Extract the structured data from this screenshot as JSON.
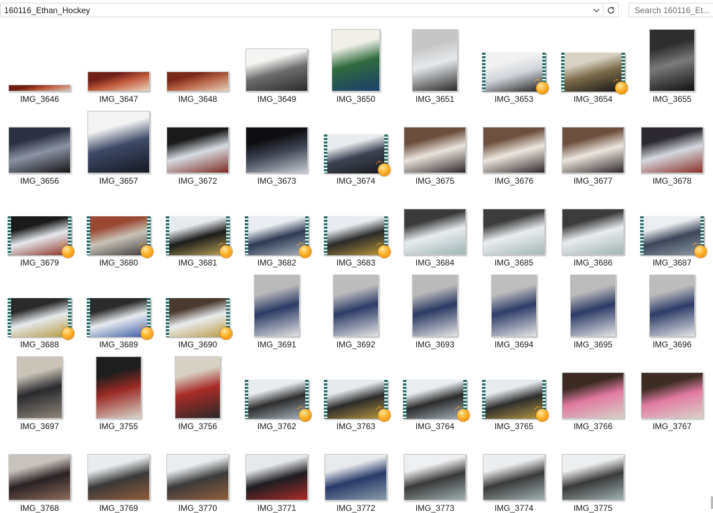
{
  "toolbar": {
    "path": "160116_Ethan_Hockey",
    "search_placeholder": "Search 160116_Et..."
  },
  "items": [
    {
      "name": "IMG_3646",
      "shape": "wide-thin",
      "video": false,
      "colors": [
        "#6b1f14",
        "#b8553a",
        "#d9c2b3"
      ]
    },
    {
      "name": "IMG_3647",
      "shape": "wide",
      "video": false,
      "colors": [
        "#6e2018",
        "#c35a3c",
        "#e8d3c0"
      ]
    },
    {
      "name": "IMG_3648",
      "shape": "wide",
      "video": false,
      "colors": [
        "#7a2a1a",
        "#b66446",
        "#e6cdb8"
      ]
    },
    {
      "name": "IMG_3649",
      "shape": "doc",
      "video": false,
      "colors": [
        "#f4f4f2",
        "#6d6d6d",
        "#2a2a2a"
      ]
    },
    {
      "name": "IMG_3650",
      "shape": "poster",
      "video": false,
      "colors": [
        "#efefe8",
        "#2f6a3e",
        "#1c3f6b"
      ]
    },
    {
      "name": "IMG_3651",
      "shape": "portrait",
      "video": false,
      "colors": [
        "#c6c6c6",
        "#e6e8ea",
        "#2a2a2a"
      ]
    },
    {
      "name": "IMG_3653",
      "shape": "video",
      "video": true,
      "colors": [
        "#f0f0f0",
        "#d0d4da",
        "#202020"
      ]
    },
    {
      "name": "IMG_3654",
      "shape": "video",
      "video": true,
      "colors": [
        "#d8d2c4",
        "#7a6a4a",
        "#151515"
      ]
    },
    {
      "name": "IMG_3655",
      "shape": "portrait",
      "video": false,
      "colors": [
        "#2e2e2e",
        "#7a7a7a",
        "#101010"
      ]
    },
    {
      "name": "IMG_3656",
      "shape": "landscape",
      "video": false,
      "colors": [
        "#2b3140",
        "#8b92a3",
        "#141414"
      ]
    },
    {
      "name": "IMG_3657",
      "shape": "square",
      "video": false,
      "colors": [
        "#f3f3f3",
        "#3f4a66",
        "#141820"
      ]
    },
    {
      "name": "IMG_3672",
      "shape": "landscape",
      "video": false,
      "colors": [
        "#1a1a1a",
        "#d7dde3",
        "#7b2a22"
      ]
    },
    {
      "name": "IMG_3673",
      "shape": "landscape",
      "video": false,
      "colors": [
        "#0f0f12",
        "#3e4452",
        "#c6ccd2"
      ]
    },
    {
      "name": "IMG_3674",
      "shape": "video",
      "video": true,
      "colors": [
        "#e9ecef",
        "#3b4252",
        "#1a1a1a"
      ]
    },
    {
      "name": "IMG_3675",
      "shape": "landscape",
      "video": false,
      "colors": [
        "#6a4e3e",
        "#e9e3dc",
        "#2a2428"
      ]
    },
    {
      "name": "IMG_3676",
      "shape": "landscape",
      "video": false,
      "colors": [
        "#6d5140",
        "#ece6de",
        "#2c262a"
      ]
    },
    {
      "name": "IMG_3677",
      "shape": "landscape",
      "video": false,
      "colors": [
        "#6b4f3f",
        "#ebe5dd",
        "#2b2529"
      ]
    },
    {
      "name": "IMG_3678",
      "shape": "landscape",
      "video": false,
      "colors": [
        "#2c2a30",
        "#d4d8de",
        "#8a2e28"
      ]
    },
    {
      "name": "IMG_3679",
      "shape": "video",
      "video": true,
      "colors": [
        "#1a1a1a",
        "#e5e8ec",
        "#8a2f27"
      ]
    },
    {
      "name": "IMG_3680",
      "shape": "video",
      "video": true,
      "colors": [
        "#9a4a33",
        "#c9c2b8",
        "#3b3b3b"
      ]
    },
    {
      "name": "IMG_3681",
      "shape": "video",
      "video": true,
      "colors": [
        "#e7eaee",
        "#1c1c1c",
        "#b8a55a"
      ]
    },
    {
      "name": "IMG_3682",
      "shape": "video",
      "video": true,
      "colors": [
        "#e9edf1",
        "#2f3a52",
        "#a9b4be"
      ]
    },
    {
      "name": "IMG_3683",
      "shape": "video",
      "video": true,
      "colors": [
        "#e8ecf0",
        "#2a2a2a",
        "#b89a3a"
      ]
    },
    {
      "name": "IMG_3684",
      "shape": "landscape",
      "video": false,
      "colors": [
        "#3a3a3a",
        "#e8ecef",
        "#9fb3b3"
      ]
    },
    {
      "name": "IMG_3685",
      "shape": "landscape",
      "video": false,
      "colors": [
        "#3c3c3c",
        "#eaedf0",
        "#a3b5b5"
      ]
    },
    {
      "name": "IMG_3686",
      "shape": "landscape",
      "video": false,
      "colors": [
        "#3b3b3b",
        "#e9ecef",
        "#a0b2b2"
      ]
    },
    {
      "name": "IMG_3687",
      "shape": "video",
      "video": true,
      "colors": [
        "#ebeef1",
        "#3c4658",
        "#8e9aa6"
      ]
    },
    {
      "name": "IMG_3688",
      "shape": "video",
      "video": true,
      "colors": [
        "#2a2a2a",
        "#e6e9ec",
        "#b39a42"
      ]
    },
    {
      "name": "IMG_3689",
      "shape": "video",
      "video": true,
      "colors": [
        "#2c2c2c",
        "#e8ebee",
        "#3a5aa8"
      ]
    },
    {
      "name": "IMG_3690",
      "shape": "video",
      "video": true,
      "colors": [
        "#4a3a30",
        "#e9ecee",
        "#b79b45"
      ]
    },
    {
      "name": "IMG_3691",
      "shape": "portrait",
      "video": false,
      "colors": [
        "#b9b9b9",
        "#2c3a66",
        "#e3e3e3"
      ]
    },
    {
      "name": "IMG_3692",
      "shape": "portrait",
      "video": false,
      "colors": [
        "#bcbcbc",
        "#2d3b68",
        "#e5e5e5"
      ]
    },
    {
      "name": "IMG_3693",
      "shape": "portrait",
      "video": false,
      "colors": [
        "#bababa",
        "#2b3964",
        "#e4e4e4"
      ]
    },
    {
      "name": "IMG_3694",
      "shape": "portrait",
      "video": false,
      "colors": [
        "#bdbdbd",
        "#2e3c6a",
        "#e6e6e6"
      ]
    },
    {
      "name": "IMG_3695",
      "shape": "portrait",
      "video": false,
      "colors": [
        "#bbbbbb",
        "#2c3a67",
        "#e5e5e5"
      ]
    },
    {
      "name": "IMG_3696",
      "shape": "portrait",
      "video": false,
      "colors": [
        "#bcbcbc",
        "#2d3b69",
        "#e5e5e5"
      ]
    },
    {
      "name": "IMG_3697",
      "shape": "portrait",
      "video": false,
      "colors": [
        "#c9c3b8",
        "#2a2a2e",
        "#8d8579"
      ]
    },
    {
      "name": "IMG_3755",
      "shape": "portrait",
      "video": false,
      "colors": [
        "#1e1e1e",
        "#9b2a25",
        "#d9d4ca"
      ]
    },
    {
      "name": "IMG_3756",
      "shape": "portrait",
      "video": false,
      "colors": [
        "#d7d0c4",
        "#a82b26",
        "#2a2a2a"
      ]
    },
    {
      "name": "IMG_3762",
      "shape": "video",
      "video": true,
      "colors": [
        "#e8ecef",
        "#2e2e2e",
        "#a8b4bc"
      ]
    },
    {
      "name": "IMG_3763",
      "shape": "video",
      "video": true,
      "colors": [
        "#e6eaed",
        "#2b2b2b",
        "#b69a40"
      ]
    },
    {
      "name": "IMG_3764",
      "shape": "video",
      "video": true,
      "colors": [
        "#e9edf0",
        "#2c2c2c",
        "#a6b2ba"
      ]
    },
    {
      "name": "IMG_3765",
      "shape": "video",
      "video": true,
      "colors": [
        "#e7ebee",
        "#2d2d2d",
        "#b49b44"
      ]
    },
    {
      "name": "IMG_3766",
      "shape": "landscape",
      "video": false,
      "colors": [
        "#3a2a22",
        "#e07aa0",
        "#d8d0c8"
      ]
    },
    {
      "name": "IMG_3767",
      "shape": "landscape",
      "video": false,
      "colors": [
        "#3c2c24",
        "#e27ca2",
        "#dad2ca"
      ]
    },
    {
      "name": "IMG_3768",
      "shape": "landscape",
      "video": false,
      "colors": [
        "#c8c2bc",
        "#2a2224",
        "#8a6a5a"
      ]
    },
    {
      "name": "IMG_3769",
      "shape": "landscape",
      "video": false,
      "colors": [
        "#e9ecee",
        "#3a3a3a",
        "#8e5a3a"
      ]
    },
    {
      "name": "IMG_3770",
      "shape": "landscape",
      "video": false,
      "colors": [
        "#eaedef",
        "#3c3c3c",
        "#905c3c"
      ]
    },
    {
      "name": "IMG_3771",
      "shape": "landscape",
      "video": false,
      "colors": [
        "#e6e8ea",
        "#1e1e22",
        "#a82a2a"
      ]
    },
    {
      "name": "IMG_3772",
      "shape": "landscape",
      "video": false,
      "colors": [
        "#e8eaec",
        "#2a3a6a",
        "#8a9aaa"
      ]
    },
    {
      "name": "IMG_3773",
      "shape": "landscape",
      "video": false,
      "colors": [
        "#eeeff0",
        "#3a3a3a",
        "#a0b0b0"
      ]
    },
    {
      "name": "IMG_3774",
      "shape": "landscape",
      "video": false,
      "colors": [
        "#ecedee",
        "#3b3b3b",
        "#a2b2b2"
      ]
    },
    {
      "name": "IMG_3775",
      "shape": "landscape",
      "video": false,
      "colors": [
        "#edeeef",
        "#3a3a3a",
        "#a1b1b1"
      ]
    }
  ]
}
